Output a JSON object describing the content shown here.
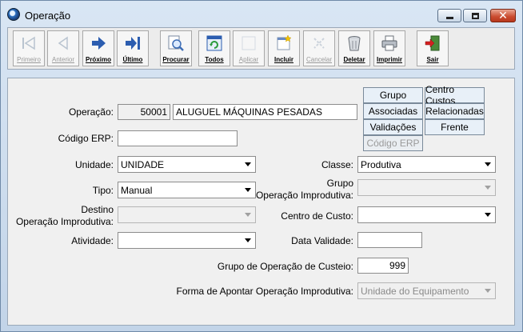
{
  "window": {
    "title": "Operação"
  },
  "toolbar": {
    "buttons": [
      {
        "label": "Primeiro",
        "icon": "first-record-icon",
        "enabled": false
      },
      {
        "label": "Anterior",
        "icon": "previous-record-icon",
        "enabled": false
      },
      {
        "label": "Próximo",
        "icon": "next-record-icon",
        "enabled": true
      },
      {
        "label": "Último",
        "icon": "last-record-icon",
        "enabled": true
      },
      {
        "label": "Procurar",
        "icon": "search-icon",
        "enabled": true
      },
      {
        "label": "Todos",
        "icon": "refresh-all-icon",
        "enabled": true
      },
      {
        "label": "Aplicar",
        "icon": "apply-icon",
        "enabled": false
      },
      {
        "label": "Incluir",
        "icon": "new-document-icon",
        "enabled": true
      },
      {
        "label": "Cancelar",
        "icon": "cancel-icon",
        "enabled": false
      },
      {
        "label": "Deletar",
        "icon": "trash-icon",
        "enabled": true
      },
      {
        "label": "Imprimir",
        "icon": "printer-icon",
        "enabled": true
      },
      {
        "label": "Sair",
        "icon": "exit-door-icon",
        "enabled": true
      }
    ]
  },
  "side_buttons": {
    "grupo": "Grupo",
    "centro_custos": "Centro Custos",
    "associadas": "Associadas",
    "relacionadas": "Relacionadas",
    "validacoes": "Validações",
    "frente": "Frente",
    "codigo_erp": "Código ERP"
  },
  "form": {
    "operacao": {
      "label": "Operação:",
      "code": "50001",
      "description": "ALUGUEL MÁQUINAS PESADAS"
    },
    "codigo_erp": {
      "label": "Código ERP:",
      "value": ""
    },
    "unidade": {
      "label": "Unidade:",
      "value": "UNIDADE"
    },
    "classe": {
      "label": "Classe:",
      "value": "Produtiva"
    },
    "tipo": {
      "label": "Tipo:",
      "value": "Manual"
    },
    "grupo_op_improdutiva": {
      "label_line1": "Grupo",
      "label_line2": "Operação Improdutiva:",
      "value": ""
    },
    "destino_op_improdutiva": {
      "label_line1": "Destino",
      "label_line2": "Operação Improdutiva:",
      "value": ""
    },
    "centro_custo": {
      "label": "Centro de Custo:",
      "value": ""
    },
    "atividade": {
      "label": "Atividade:",
      "value": ""
    },
    "data_validade": {
      "label": "Data Validade:",
      "value": ""
    },
    "grupo_custeio": {
      "label": "Grupo de Operação de Custeio:",
      "value": "999"
    },
    "forma_apontar": {
      "label": "Forma de Apontar Operação Improdutiva:",
      "value": "Unidade do Equipamento"
    }
  }
}
